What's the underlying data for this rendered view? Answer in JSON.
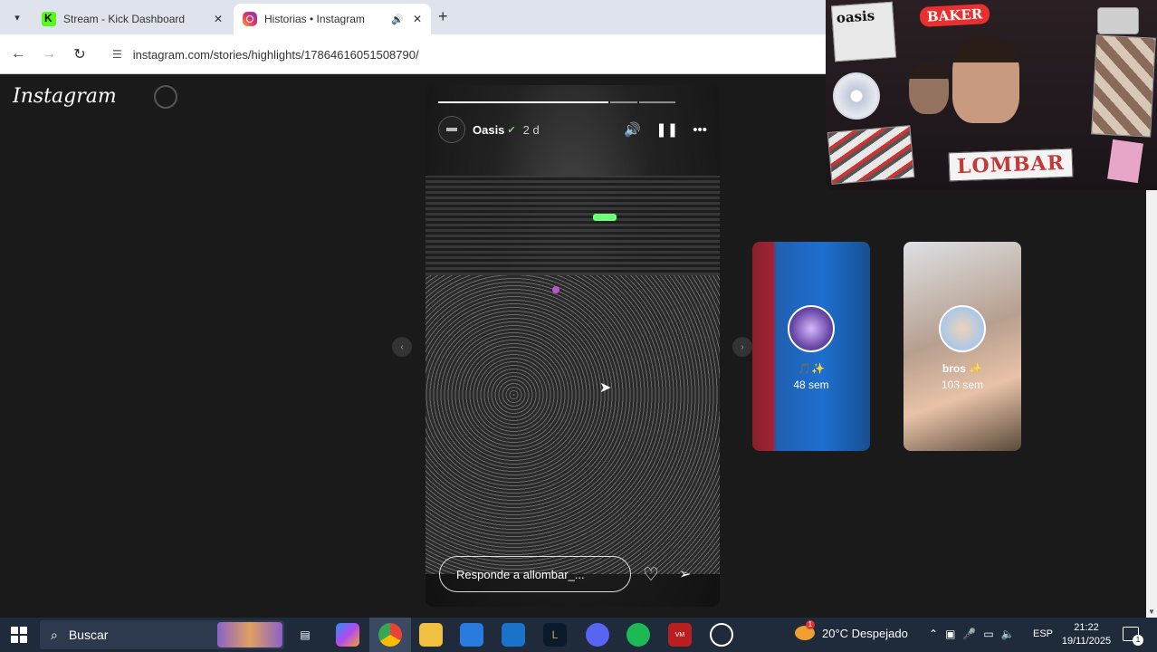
{
  "browser": {
    "tabs": [
      {
        "title": "Stream - Kick Dashboard"
      },
      {
        "title": "Historias • Instagram"
      }
    ],
    "url": "instagram.com/stories/highlights/17864616051508790/"
  },
  "instagram": {
    "logo": "Instagram",
    "story": {
      "username": "Oasis",
      "time_ago": "2 d",
      "reply_placeholder": "Responde a allombar_..."
    },
    "highlights": [
      {
        "title": "🎵✨",
        "time": "48 sem"
      },
      {
        "title": "bros ✨",
        "time": "103 sem"
      }
    ]
  },
  "overlay": {
    "oasis_text": "oasis",
    "baker_text": "BAKER",
    "lombar_text": "LOMBAR"
  },
  "taskbar": {
    "search_placeholder": "Buscar",
    "weather": "20°C Despejado",
    "language": "ESP",
    "time": "21:22",
    "date": "19/11/2025"
  }
}
